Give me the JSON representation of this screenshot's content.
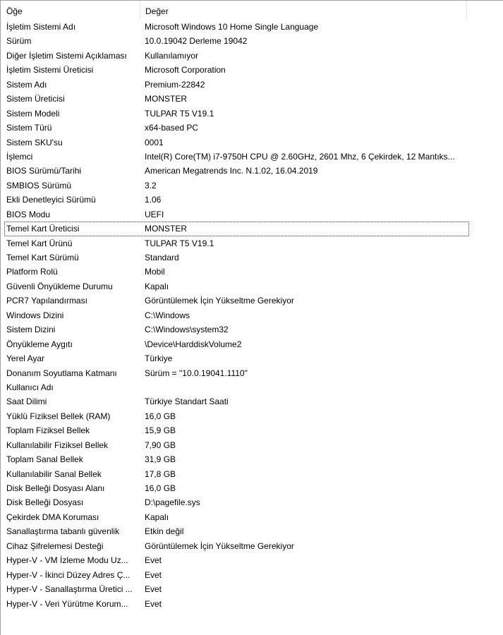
{
  "header": {
    "col_item": "Öğe",
    "col_value": "Değer"
  },
  "rows": [
    {
      "item": "İşletim Sistemi Adı",
      "value": "Microsoft Windows 10 Home Single Language"
    },
    {
      "item": "Sürüm",
      "value": "10.0.19042 Derleme 19042"
    },
    {
      "item": "Diğer İşletim Sistemi Açıklaması",
      "value": "Kullanılamıyor"
    },
    {
      "item": "İşletim Sistemi Üreticisi",
      "value": "Microsoft Corporation"
    },
    {
      "item": "Sistem Adı",
      "value": "Premium-22842"
    },
    {
      "item": "Sistem Üreticisi",
      "value": "MONSTER"
    },
    {
      "item": "Sistem Modeli",
      "value": "TULPAR T5 V19.1"
    },
    {
      "item": "Sistem Türü",
      "value": "x64-based PC"
    },
    {
      "item": "Sistem SKU'su",
      "value": "0001"
    },
    {
      "item": "İşlemci",
      "value": "Intel(R) Core(TM) i7-9750H CPU @ 2.60GHz, 2601 Mhz, 6 Çekirdek, 12 Mantıks..."
    },
    {
      "item": "BIOS Sürümü/Tarihi",
      "value": "American Megatrends Inc. N.1.02, 16.04.2019"
    },
    {
      "item": "SMBIOS Sürümü",
      "value": "3.2"
    },
    {
      "item": "Ekli Denetleyici Sürümü",
      "value": "1.06"
    },
    {
      "item": "BIOS Modu",
      "value": "UEFI"
    },
    {
      "item": "Temel Kart Üreticisi",
      "value": "MONSTER",
      "focused": true
    },
    {
      "item": "Temel Kart Ürünü",
      "value": "TULPAR T5 V19.1"
    },
    {
      "item": "Temel Kart Sürümü",
      "value": "Standard"
    },
    {
      "item": "Platform Rolü",
      "value": "Mobil"
    },
    {
      "item": "Güvenli Önyükleme Durumu",
      "value": "Kapalı"
    },
    {
      "item": "PCR7 Yapılandırması",
      "value": "Görüntülemek İçin Yükseltme Gerekiyor"
    },
    {
      "item": "Windows Dizini",
      "value": "C:\\Windows"
    },
    {
      "item": "Sistem Dizini",
      "value": "C:\\Windows\\system32"
    },
    {
      "item": "Önyükleme Aygıtı",
      "value": "\\Device\\HarddiskVolume2"
    },
    {
      "item": "Yerel Ayar",
      "value": "Türkiye"
    },
    {
      "item": "Donanım Soyutlama Katmanı",
      "value": "Sürüm = \"10.0.19041.1110\""
    },
    {
      "item": "Kullanıcı Adı",
      "value": null,
      "redacted": true
    },
    {
      "item": "Saat Dilimi",
      "value": "Türkiye Standart Saati"
    },
    {
      "item": "Yüklü Fiziksel Bellek (RAM)",
      "value": "16,0 GB"
    },
    {
      "item": "Toplam Fiziksel Bellek",
      "value": "15,9 GB"
    },
    {
      "item": "Kullanılabilir Fiziksel Bellek",
      "value": "7,90 GB"
    },
    {
      "item": "Toplam Sanal Bellek",
      "value": "31,9 GB"
    },
    {
      "item": "Kullanılabilir Sanal Bellek",
      "value": "17,8 GB"
    },
    {
      "item": "Disk Belleği Dosyası Alanı",
      "value": "16,0 GB"
    },
    {
      "item": "Disk Belleği Dosyası",
      "value": "D:\\pagefile.sys"
    },
    {
      "item": "Çekirdek DMA Koruması",
      "value": "Kapalı"
    },
    {
      "item": "Sanallaştırma tabanlı güvenlik",
      "value": "Etkin değil"
    },
    {
      "item": "Cihaz Şifrelemesi Desteği",
      "value": "Görüntülemek İçin Yükseltme Gerekiyor"
    },
    {
      "item": "Hyper-V - VM İzleme Modu Uz...",
      "value": "Evet"
    },
    {
      "item": "Hyper-V - İkinci Düzey Adres Ç...",
      "value": "Evet"
    },
    {
      "item": "Hyper-V - Sanallaştırma Üretici ...",
      "value": "Evet"
    },
    {
      "item": "Hyper-V - Veri Yürütme Korum...",
      "value": "Evet"
    }
  ],
  "colors": {
    "redaction": "#e0161c",
    "border": "#a0a0a0"
  }
}
